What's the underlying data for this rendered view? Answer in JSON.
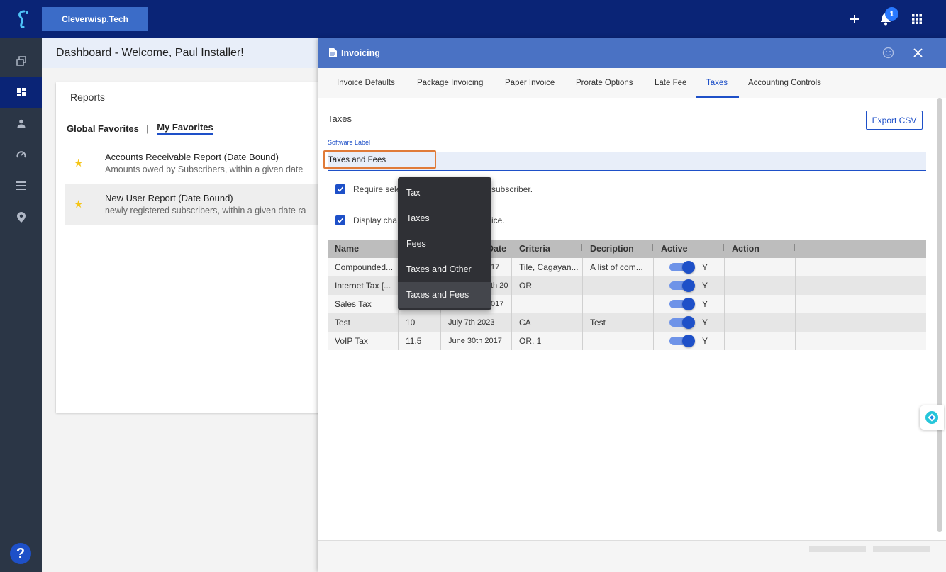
{
  "topbar": {
    "company": "Cleverwisp.Tech",
    "notification_count": "1",
    "icons": [
      "logo-icon",
      "plus-icon",
      "bell-icon",
      "apps-grid-icon"
    ]
  },
  "sidebar": {
    "items": [
      "copy-icon",
      "dashboard-icon",
      "person-icon",
      "speed-icon",
      "list-icon",
      "location-icon"
    ],
    "active": "dashboard-icon",
    "help": "?"
  },
  "dashboard": {
    "title": "Dashboard - Welcome, Paul Installer!",
    "reports": {
      "title": "Reports",
      "tabs": [
        "Global Favorites",
        "|",
        "My Favorites"
      ],
      "active_tab": "My Favorites",
      "items": [
        {
          "name": "Accounts Receivable Report (Date Bound)",
          "desc": "Amounts owed by Subscribers, within a given date"
        },
        {
          "name": "New User Report (Date Bound)",
          "desc": "newly registered subscribers, within a given date ra"
        }
      ]
    }
  },
  "panel": {
    "title": "Invoicing",
    "tabs": [
      "Invoice Defaults",
      "Package Invoicing",
      "Paper Invoice",
      "Prorate Options",
      "Late Fee",
      "Taxes",
      "Accounting Controls"
    ],
    "active_tab": "Taxes",
    "section_title": "Taxes",
    "export_label": "Export CSV",
    "software_label": {
      "label": "Software Label",
      "value": "Taxes and Fees"
    },
    "checkboxes": [
      {
        "text_before": "Require sele",
        "text_after": "subscriber.",
        "checked": true
      },
      {
        "text_before": "Display cha",
        "text_after": "ice.",
        "checked": true
      }
    ],
    "dropdown": {
      "options": [
        "Tax",
        "Taxes",
        "Fees",
        "Taxes and Other",
        "Taxes and Fees"
      ],
      "selected": "Taxes and Fees"
    },
    "table": {
      "headers": [
        "Name",
        "",
        "Date",
        "Criteria",
        "Decription",
        "Active",
        "Action"
      ],
      "rows": [
        {
          "name": "Compounded...",
          "rate": "",
          "date": "17",
          "criteria": "Tile, Cagayan...",
          "description": "A list of com...",
          "active": "Y"
        },
        {
          "name": "Internet Tax [...",
          "rate": "",
          "date": "th 20",
          "criteria": "OR",
          "description": "",
          "active": "Y"
        },
        {
          "name": "Sales Tax",
          "rate": "",
          "date": "017",
          "criteria": "",
          "description": "",
          "active": "Y"
        },
        {
          "name": "Test",
          "rate": "10",
          "date": "July 7th 2023",
          "criteria": "CA",
          "description": "Test",
          "active": "Y"
        },
        {
          "name": "VoIP Tax",
          "rate": "11.5",
          "date": "June 30th 2017",
          "criteria": "OR, 1",
          "description": "",
          "active": "Y"
        }
      ]
    }
  },
  "colors": {
    "topbar": "#0a2476",
    "sidebar": "#2b3646",
    "accent": "#1e50c8",
    "panel_header": "#4a72c4",
    "focus_outline": "#e07b39"
  }
}
